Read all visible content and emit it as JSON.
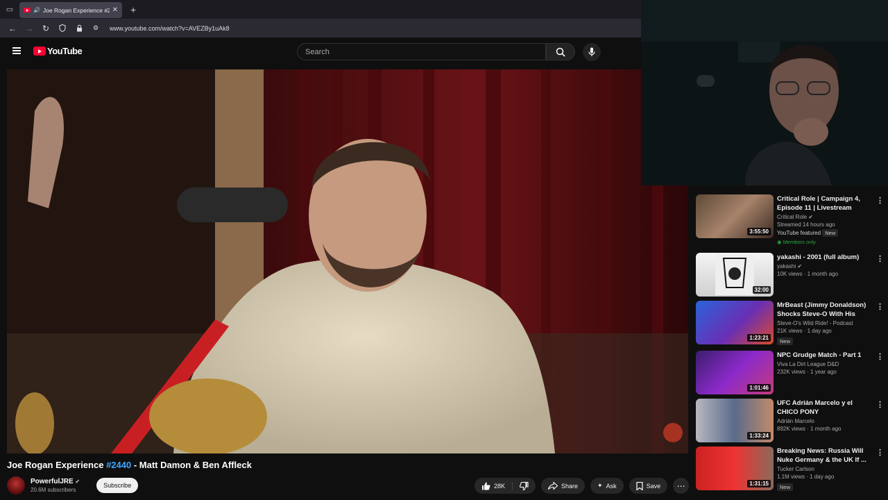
{
  "browser": {
    "tab_title": "Joe Rogan Experience #2440",
    "url": "www.youtube.com/watch?v=AVEZBy1uAk8"
  },
  "youtube": {
    "logo_text": "YouTube",
    "search_placeholder": "Search"
  },
  "video": {
    "title_prefix": "Joe Rogan Experience ",
    "title_tag": "#2440",
    "title_suffix": " - Matt Damon & Ben Affleck",
    "channel_name": "PowerfulJRE",
    "subscribers": "20.6M subscribers",
    "subscribe_label": "Subscribe",
    "likes": "28K",
    "share_label": "Share",
    "ask_label": "Ask",
    "save_label": "Save"
  },
  "recommendations": [
    {
      "title": "Critical Role | Campaign 4, Episode 11 | Livestream",
      "channel": "Critical Role",
      "stats": "Streamed 14 hours ago",
      "duration": "3:55:50",
      "featured": "YouTube featured",
      "badge": "New",
      "members": "Members only"
    },
    {
      "title": "yakashi - 2001 (full album)",
      "channel": "yakashi",
      "stats": "10K views · 1 month ago",
      "duration": "32:00"
    },
    {
      "title": "MrBeast (Jimmy Donaldson) Shocks Steve-O With His Insa...",
      "channel": "Steve-O's Wild Ride! - Podcast",
      "stats": "21K views · 1 day ago",
      "duration": "1:23:21",
      "badge": "New"
    },
    {
      "title": "NPC Grudge Match - Part 1",
      "channel": "Viva La Dirt League D&D",
      "stats": "232K views · 1 year ago",
      "duration": "1:01:46"
    },
    {
      "title": "UFC Adrián Marcelo y el CHICO PONY",
      "channel": "Adrián Marcelo",
      "stats": "892K views · 1 month ago",
      "duration": "1:33:24"
    },
    {
      "title": "Breaking News: Russia Will Nuke Germany & the UK If ...",
      "channel": "Tucker Carlson",
      "stats": "1.1M views · 1 day ago",
      "duration": "1:31:15",
      "badge": "New"
    }
  ]
}
